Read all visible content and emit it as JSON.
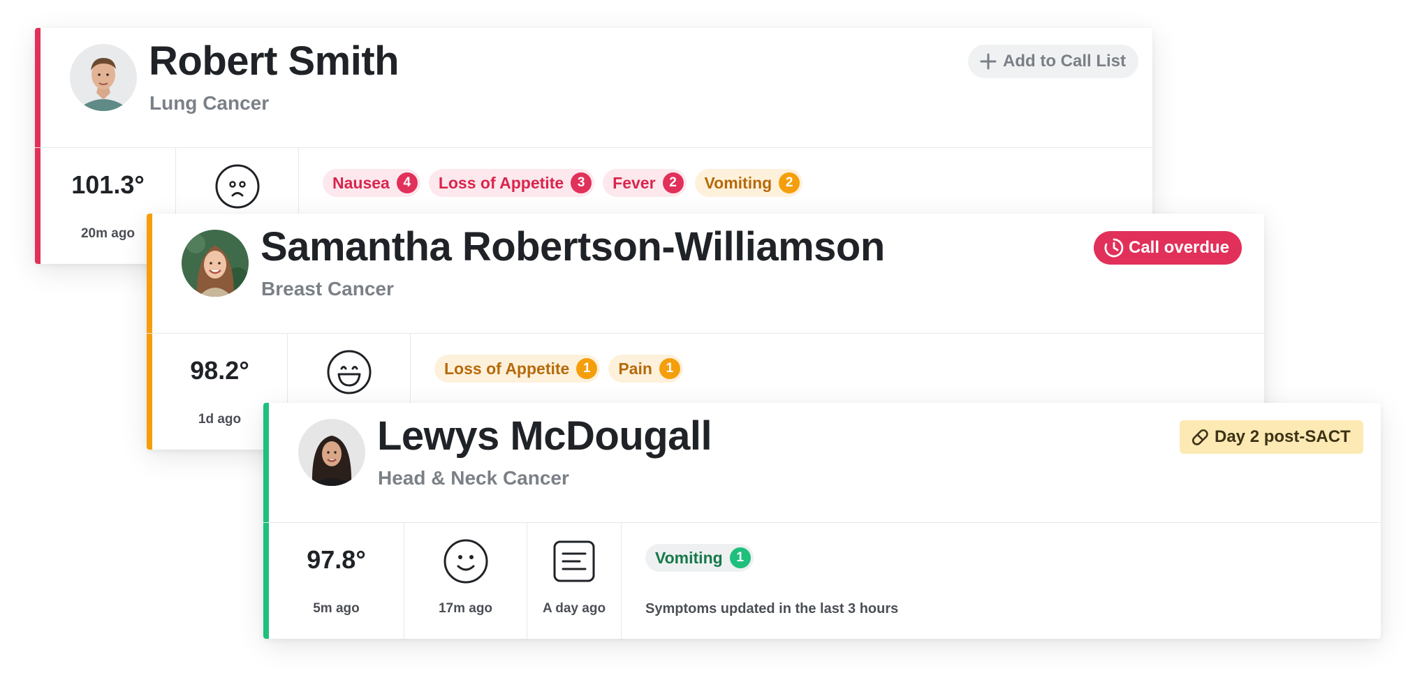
{
  "patients": [
    {
      "name": "Robert Smith",
      "diagnosis": "Lung Cancer",
      "accent_color": "#e1305a",
      "action_badge": {
        "label": "Add to Call List",
        "icon": "plus-icon"
      },
      "temperature": {
        "value": "101.3°",
        "time": "20m ago"
      },
      "mood": {
        "icon": "sad-face-icon"
      },
      "symptoms": [
        {
          "label": "Nausea",
          "count": "4",
          "severity": "red"
        },
        {
          "label": "Loss of Appetite",
          "count": "3",
          "severity": "red"
        },
        {
          "label": "Fever",
          "count": "2",
          "severity": "red"
        },
        {
          "label": "Vomiting",
          "count": "2",
          "severity": "orange"
        }
      ]
    },
    {
      "name": "Samantha Robertson-Williamson",
      "diagnosis": "Breast Cancer",
      "accent_color": "#f59e0b",
      "action_badge": {
        "label": "Call overdue",
        "icon": "clock-icon"
      },
      "temperature": {
        "value": "98.2°",
        "time": "1d ago"
      },
      "mood": {
        "icon": "grin-face-icon"
      },
      "symptoms": [
        {
          "label": "Loss of Appetite",
          "count": "1",
          "severity": "orange"
        },
        {
          "label": "Pain",
          "count": "1",
          "severity": "orange"
        }
      ]
    },
    {
      "name": "Lewys McDougall",
      "diagnosis": "Head & Neck Cancer",
      "accent_color": "#1fbf7c",
      "action_badge": {
        "label": "Day 2 post-SACT",
        "icon": "pill-icon"
      },
      "temperature": {
        "value": "97.8°",
        "time": "5m ago"
      },
      "mood": {
        "icon": "smile-face-icon",
        "time": "17m ago"
      },
      "notes": {
        "icon": "notes-icon",
        "time": "A day ago"
      },
      "symptoms": [
        {
          "label": "Vomiting",
          "count": "1",
          "severity": "green"
        }
      ],
      "symptoms_note": "Symptoms updated in the last 3 hours"
    }
  ],
  "colors": {
    "critical": "#e1305a",
    "warning": "#f59e0b",
    "stable": "#1fbf7c",
    "muted_text": "#7b8087"
  }
}
